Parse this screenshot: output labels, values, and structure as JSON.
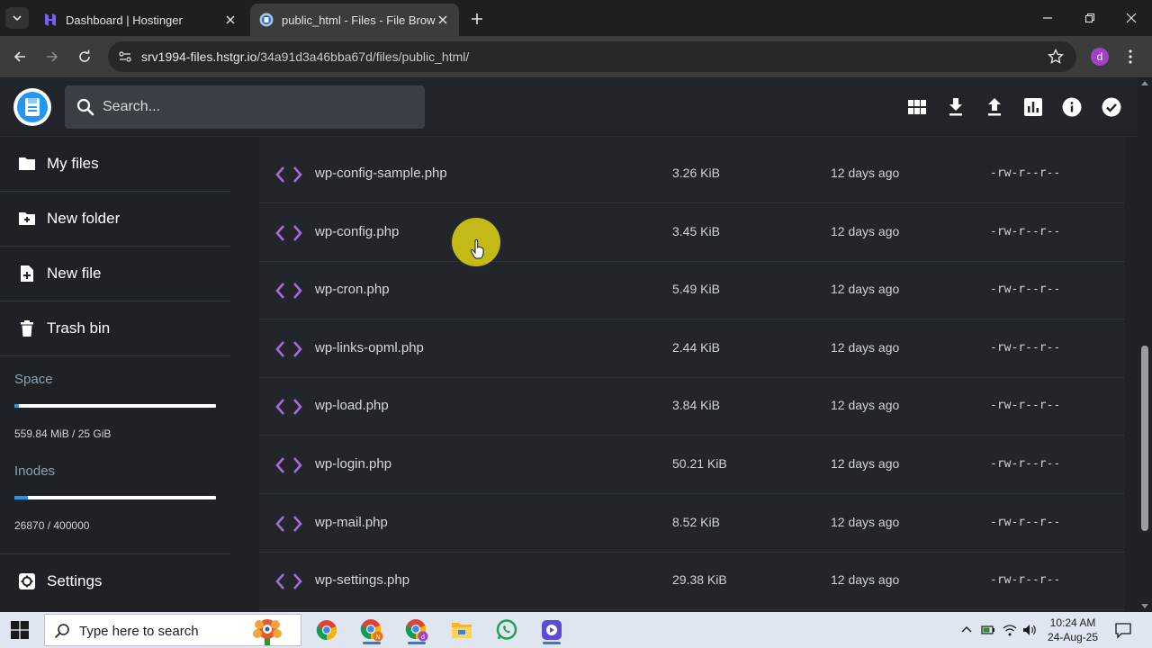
{
  "browser": {
    "tabs": [
      {
        "title": "Dashboard | Hostinger",
        "favicon": "hostinger-icon",
        "active": false
      },
      {
        "title": "public_html - Files - File Browser",
        "favicon": "filebrowser-icon",
        "active": true
      }
    ],
    "url_host": "srv1994-files.hstgr.io",
    "url_path": "/34a91d3a46bba67d/files/public_html/",
    "profile_initial": "d"
  },
  "header": {
    "search_placeholder": "Search...",
    "actions": [
      "grid-view-icon",
      "download-icon",
      "upload-icon",
      "info-bars-icon",
      "info-icon",
      "select-check-icon"
    ]
  },
  "sidebar": {
    "items": [
      {
        "label": "My files",
        "icon": "folder-icon"
      },
      {
        "label": "New folder",
        "icon": "new-folder-icon"
      },
      {
        "label": "New file",
        "icon": "new-file-icon"
      },
      {
        "label": "Trash bin",
        "icon": "trash-icon"
      }
    ],
    "space": {
      "label": "Space",
      "value": "559.84 MiB / 25 GiB",
      "fraction": 0.022
    },
    "inodes": {
      "label": "Inodes",
      "value": "26870 / 400000",
      "fraction": 0.067
    },
    "settings_label": "Settings"
  },
  "files": [
    {
      "name": "wp-config-sample.php",
      "size": "3.26 KiB",
      "modified": "12 days ago",
      "permissions": "-rw-r--r--"
    },
    {
      "name": "wp-config.php",
      "size": "3.45 KiB",
      "modified": "12 days ago",
      "permissions": "-rw-r--r--"
    },
    {
      "name": "wp-cron.php",
      "size": "5.49 KiB",
      "modified": "12 days ago",
      "permissions": "-rw-r--r--"
    },
    {
      "name": "wp-links-opml.php",
      "size": "2.44 KiB",
      "modified": "12 days ago",
      "permissions": "-rw-r--r--"
    },
    {
      "name": "wp-load.php",
      "size": "3.84 KiB",
      "modified": "12 days ago",
      "permissions": "-rw-r--r--"
    },
    {
      "name": "wp-login.php",
      "size": "50.21 KiB",
      "modified": "12 days ago",
      "permissions": "-rw-r--r--"
    },
    {
      "name": "wp-mail.php",
      "size": "8.52 KiB",
      "modified": "12 days ago",
      "permissions": "-rw-r--r--"
    },
    {
      "name": "wp-settings.php",
      "size": "29.38 KiB",
      "modified": "12 days ago",
      "permissions": "-rw-r--r--"
    }
  ],
  "taskbar": {
    "search_placeholder": "Type here to search",
    "time": "10:24 AM",
    "date": "24-Aug-25",
    "apps": [
      "chrome-icon",
      "chrome-profile-n-icon",
      "chrome-profile-d-icon",
      "file-explorer-icon",
      "whatsapp-icon",
      "screen-recorder-icon"
    ]
  },
  "colors": {
    "accent": "#2196f3",
    "code_icon": "#a66bd6",
    "cursor_highlight": "#e6dc14"
  }
}
